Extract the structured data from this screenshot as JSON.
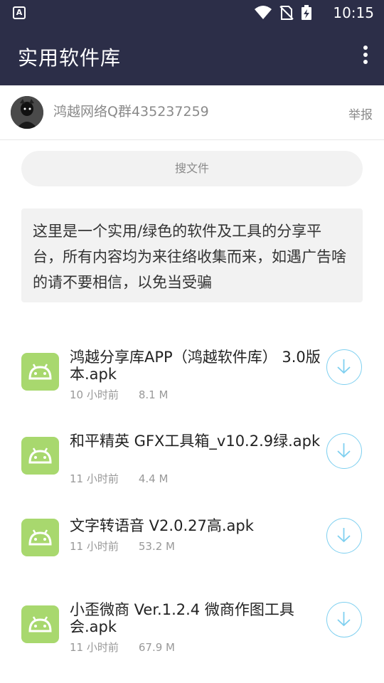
{
  "status_bar": {
    "time": "10:15",
    "notification_icon": "A"
  },
  "app_bar": {
    "title": "实用软件库"
  },
  "user": {
    "name": "鸿越网络Q群435237259",
    "report_label": "举报"
  },
  "search": {
    "placeholder": "搜文件"
  },
  "notice": {
    "text": "这里是一个实用/绿色的软件及工具的分享平台，所有内容均为来往络收集而来，如遇广告啥的请不要相信，以免当受骗"
  },
  "files": [
    {
      "name": "鸿越分享库APP（鸿越软件库） 3.0版本.apk",
      "time": "10 小时前",
      "size": "8.1 M"
    },
    {
      "name": "和平精英 GFX工具箱_v10.2.9绿.apk",
      "time": "11 小时前",
      "size": "4.4 M"
    },
    {
      "name": "文字转语音 V2.0.27高.apk",
      "time": "11 小时前",
      "size": "53.2 M"
    },
    {
      "name": "小歪微商 Ver.1.2.4 微商作图工具会.apk",
      "time": "11 小时前",
      "size": "67.9 M"
    }
  ],
  "colors": {
    "app_bar": "#2c2e48",
    "android_icon": "#a8d86e",
    "download_accent": "#7fd0f0"
  },
  "icons": {
    "file_icon": "android-icon",
    "action_icon": "download-icon"
  }
}
